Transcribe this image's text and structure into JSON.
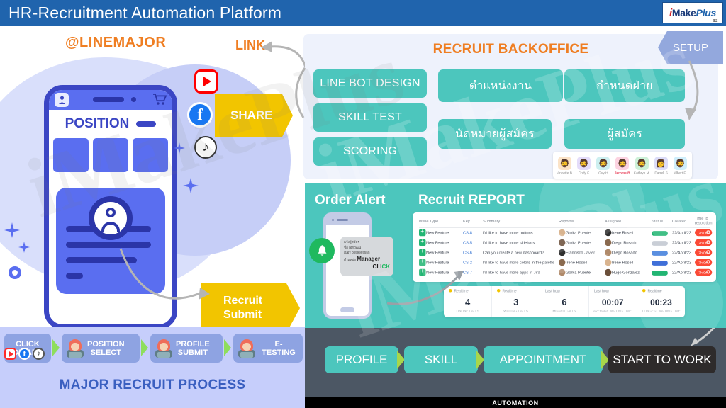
{
  "header": {
    "title": "HR-Recruitment  Automation Platform",
    "logo": {
      "i": "i",
      "make": "Make",
      "plus": "Plus",
      "biz": "BIZ"
    }
  },
  "watermark": {
    "text": "iMakePlus"
  },
  "left": {
    "line_handle": "@LINEMAJOR",
    "link_label": "LINK",
    "share_label": "SHARE",
    "submit_label_1": "Recruit",
    "submit_label_2": "Submit",
    "phone": {
      "screen_title": "POSITION"
    },
    "social": {
      "youtube": "youtube-icon",
      "facebook": "f",
      "tiktok": "♪"
    }
  },
  "backoffice": {
    "title": "RECRUIT BACKOFFICE",
    "setup_label": "SETUP",
    "buttons": [
      {
        "label": "LINE BOT DESIGN"
      },
      {
        "label": "SKILL TEST"
      },
      {
        "label": "SCORING"
      },
      {
        "label": "ตำแหน่งงาน"
      },
      {
        "label": "นัดหมายผู้สมัคร"
      },
      {
        "label": "กำหนดฝ่าย"
      },
      {
        "label": "ผู้สมัคร"
      }
    ],
    "avatars": [
      {
        "name": "Annette B",
        "bg": "#fbe3c7",
        "glyph": "🧔",
        "active": false
      },
      {
        "name": "Cody F",
        "bg": "#e4dcfa",
        "glyph": "🧔",
        "active": false
      },
      {
        "name": "Guy H",
        "bg": "#cdeff0",
        "glyph": "🧔",
        "active": false
      },
      {
        "name": "Jerome B",
        "bg": "#fcd3e1",
        "glyph": "🧔",
        "active": true
      },
      {
        "name": "Kathryn M",
        "bg": "#cdf1d8",
        "glyph": "🧔",
        "active": false
      },
      {
        "name": "Darrell S",
        "bg": "#dcdcf8",
        "glyph": "👩",
        "active": false
      },
      {
        "name": "Albert F",
        "bg": "#cfeefb",
        "glyph": "🧔",
        "active": false
      }
    ]
  },
  "report": {
    "order_alert_title": "Order Alert",
    "recruit_report_title": "Recruit REPORT",
    "toast": {
      "l1": "แจ้งผู้สมัคร",
      "l2": "ชื่อ เอกวัฒน์",
      "l3": "เบอร์ 0899995555",
      "l4_prefix": "ตำแหน่ง",
      "l4_role": "Manager",
      "click_a": "CLI",
      "click_b": "CK"
    },
    "table": {
      "columns": [
        "Issue Type",
        "Key",
        "Summary",
        "Reporter",
        "Assignee",
        "Status",
        "Created",
        "Time to resolution"
      ],
      "rows": [
        {
          "type": "New Feature",
          "key": "CS-8",
          "summary": "I'd like to have more buttons",
          "reporter": "Gorka Puente",
          "assignee": "Irene Rosell",
          "status_color": "#22b573",
          "created": "22/April/23",
          "resolution": "7h 0m"
        },
        {
          "type": "New Feature",
          "key": "CS-5",
          "summary": "I'd like to have more sidebars",
          "reporter": "Gorka Puente",
          "assignee": "Diego Rosado",
          "status_color": "#c9ced6",
          "created": "22/April/23",
          "resolution": "7h 0m"
        },
        {
          "type": "New Feature",
          "key": "CS-6",
          "summary": "Can you create a new dashboard?",
          "reporter": "Francisco Javier",
          "assignee": "Diego Rosado",
          "status_color": "#5a8fe0",
          "created": "22/April/23",
          "resolution": "7h 0m"
        },
        {
          "type": "New Feature",
          "key": "CS-2",
          "summary": "I'd like to have more colors in the palette",
          "reporter": "Irene Rosell",
          "assignee": "Irene Rosell",
          "status_color": "#3f6fd8",
          "created": "22/April/23",
          "resolution": "7h 0m"
        },
        {
          "type": "New Feature",
          "key": "CS-7",
          "summary": "I'd like to have more apps in Jira",
          "reporter": "Gorka Puente",
          "assignee": "Hugo Gonzalez",
          "status_color": "#22b573",
          "created": "22/April/23",
          "resolution": "7h 0m"
        }
      ]
    },
    "stats": [
      {
        "tag": "Realtime",
        "dot": true,
        "value": "4",
        "label": "ONLINE CALLS"
      },
      {
        "tag": "Realtime",
        "dot": true,
        "value": "3",
        "label": "WAITING CALLS"
      },
      {
        "tag": "Last hour",
        "dot": false,
        "value": "6",
        "label": "MISSED CALLS"
      },
      {
        "tag": "Last hour",
        "dot": false,
        "value": "00:07",
        "label": "AVERAGE WAITING TIME"
      },
      {
        "tag": "Realtime",
        "dot": true,
        "value": "00:23",
        "label": "LONGEST WAITING TIME"
      }
    ]
  },
  "process_left": {
    "title": "MAJOR RECRUIT PROCESS",
    "steps": [
      {
        "l1": "CLICK",
        "l2": "ON ADS",
        "has_avatar": false
      },
      {
        "l1": "POSITION",
        "l2": "SELECT",
        "has_avatar": true
      },
      {
        "l1": "PROFILE",
        "l2": "SUBMIT",
        "has_avatar": true
      },
      {
        "l1": "E-TESTING",
        "l2": "",
        "has_avatar": true
      }
    ]
  },
  "process_right": {
    "steps": [
      {
        "label": "PROFILE",
        "dark": false
      },
      {
        "label": "SKILL",
        "dark": false
      },
      {
        "label": "APPOINTMENT",
        "dark": false
      },
      {
        "label": "START TO WORK",
        "dark": true
      }
    ],
    "footer": "AUTOMATION"
  },
  "colors": {
    "header_blue": "#2064ad",
    "teal": "#4cc6bd",
    "orange": "#ef7e22",
    "yellow": "#f2c500",
    "periwinkle": "#c6cefb",
    "indigo": "#5a6ef0",
    "slate": "#4c5764"
  }
}
